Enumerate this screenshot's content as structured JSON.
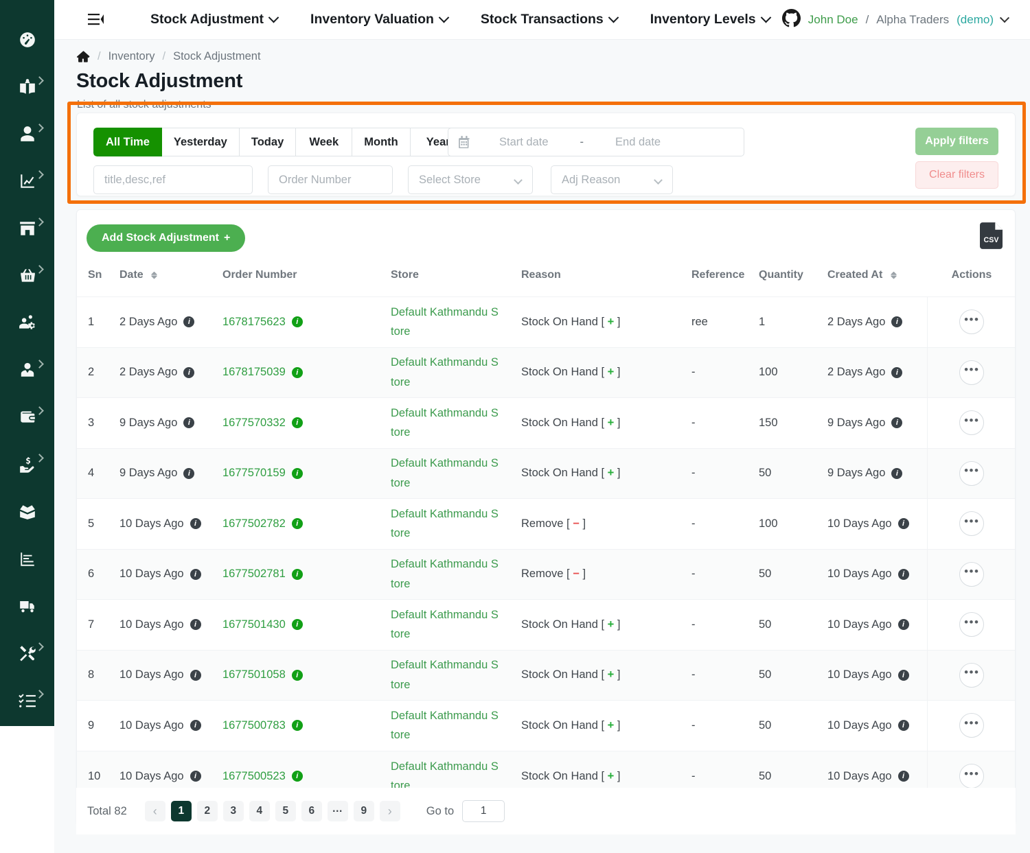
{
  "sidebar": {
    "items": [
      {
        "icon": "dashboard-gauge-icon",
        "expandable": false
      },
      {
        "icon": "book-user-icon",
        "expandable": true
      },
      {
        "icon": "user-icon",
        "expandable": true
      },
      {
        "icon": "chart-line-icon",
        "expandable": true
      },
      {
        "icon": "store-icon",
        "expandable": true
      },
      {
        "icon": "shopping-basket-icon",
        "expandable": true
      },
      {
        "icon": "users-cog-icon",
        "expandable": false
      },
      {
        "icon": "user-tie-icon",
        "expandable": true
      },
      {
        "icon": "wallet-icon",
        "expandable": true
      },
      {
        "icon": "hand-holding-dollar-icon",
        "expandable": true
      },
      {
        "icon": "box-open-icon",
        "expandable": false
      },
      {
        "icon": "chart-bar-report-icon",
        "expandable": false
      },
      {
        "icon": "truck-delivery-icon",
        "expandable": false
      },
      {
        "icon": "tools-icon",
        "expandable": true
      },
      {
        "icon": "tasks-checklist-icon",
        "expandable": true
      }
    ]
  },
  "topnav": {
    "menu_icon": "hamburger-collapse-icon",
    "links": [
      {
        "label": "Stock Adjustment"
      },
      {
        "label": "Inventory Valuation"
      },
      {
        "label": "Stock Transactions"
      },
      {
        "label": "Inventory Levels"
      }
    ],
    "user": {
      "avatar_icon": "github-mark-icon",
      "name": "John Doe",
      "separator": "/",
      "org": "Alpha Traders",
      "mode": "(demo)"
    }
  },
  "breadcrumb": {
    "home_icon": "home-icon",
    "sep": "/",
    "items": [
      "Inventory",
      "Stock Adjustment"
    ]
  },
  "header": {
    "title": "Stock Adjustment",
    "subtitle": "List of all stock adjustments"
  },
  "filters": {
    "ranges": [
      {
        "label": "All Time",
        "active": true
      },
      {
        "label": "Yesterday",
        "active": false
      },
      {
        "label": "Today",
        "active": false
      },
      {
        "label": "Week",
        "active": false
      },
      {
        "label": "Month",
        "active": false
      },
      {
        "label": "Year",
        "active": false
      }
    ],
    "date_icon": "calendar-icon",
    "start_date_placeholder": "Start date",
    "date_separator": "-",
    "end_date_placeholder": "End date",
    "search_placeholder": "title,desc,ref",
    "order_placeholder": "Order Number",
    "store_placeholder": "Select Store",
    "reason_placeholder": "Adj Reason",
    "apply_label": "Apply filters",
    "clear_label": "Clear filters"
  },
  "toolbar": {
    "add_label": "Add Stock Adjustment",
    "add_plus": "+",
    "export_icon": "csv-file-icon",
    "export_text": "CSV"
  },
  "table": {
    "columns": [
      {
        "label": "Sn",
        "sortable": false
      },
      {
        "label": "Date",
        "sortable": true
      },
      {
        "label": "Order Number",
        "sortable": false
      },
      {
        "label": "Store",
        "sortable": false
      },
      {
        "label": "Reason",
        "sortable": false
      },
      {
        "label": "Reference",
        "sortable": false
      },
      {
        "label": "Quantity",
        "sortable": false
      },
      {
        "label": "Created At",
        "sortable": true
      },
      {
        "label": "Actions",
        "sortable": false
      }
    ],
    "store_name": "Default Kathmandu Store",
    "actions_glyph": "•••",
    "rows": [
      {
        "sn": "1",
        "date": "2 Days Ago",
        "order": "1678175623",
        "store": "Default Kathmandu Store",
        "reason": "Stock On Hand",
        "sign": "+",
        "reference": "ree",
        "quantity": "1",
        "created": "2 Days Ago"
      },
      {
        "sn": "2",
        "date": "2 Days Ago",
        "order": "1678175039",
        "store": "Default Kathmandu Store",
        "reason": "Stock On Hand",
        "sign": "+",
        "reference": "-",
        "quantity": "100",
        "created": "2 Days Ago"
      },
      {
        "sn": "3",
        "date": "9 Days Ago",
        "order": "1677570332",
        "store": "Default Kathmandu Store",
        "reason": "Stock On Hand",
        "sign": "+",
        "reference": "-",
        "quantity": "150",
        "created": "9 Days Ago"
      },
      {
        "sn": "4",
        "date": "9 Days Ago",
        "order": "1677570159",
        "store": "Default Kathmandu Store",
        "reason": "Stock On Hand",
        "sign": "+",
        "reference": "-",
        "quantity": "50",
        "created": "9 Days Ago"
      },
      {
        "sn": "5",
        "date": "10 Days Ago",
        "order": "1677502782",
        "store": "Default Kathmandu Store",
        "reason": "Remove",
        "sign": "-",
        "reference": "-",
        "quantity": "100",
        "created": "10 Days Ago"
      },
      {
        "sn": "6",
        "date": "10 Days Ago",
        "order": "1677502781",
        "store": "Default Kathmandu Store",
        "reason": "Remove",
        "sign": "-",
        "reference": "-",
        "quantity": "50",
        "created": "10 Days Ago"
      },
      {
        "sn": "7",
        "date": "10 Days Ago",
        "order": "1677501430",
        "store": "Default Kathmandu Store",
        "reason": "Stock On Hand",
        "sign": "+",
        "reference": "-",
        "quantity": "50",
        "created": "10 Days Ago"
      },
      {
        "sn": "8",
        "date": "10 Days Ago",
        "order": "1677501058",
        "store": "Default Kathmandu Store",
        "reason": "Stock On Hand",
        "sign": "+",
        "reference": "-",
        "quantity": "50",
        "created": "10 Days Ago"
      },
      {
        "sn": "9",
        "date": "10 Days Ago",
        "order": "1677500783",
        "store": "Default Kathmandu Store",
        "reason": "Stock On Hand",
        "sign": "+",
        "reference": "-",
        "quantity": "50",
        "created": "10 Days Ago"
      },
      {
        "sn": "10",
        "date": "10 Days Ago",
        "order": "1677500523",
        "store": "Default Kathmandu Store",
        "reason": "Stock On Hand",
        "sign": "+",
        "reference": "-",
        "quantity": "50",
        "created": "10 Days Ago"
      }
    ]
  },
  "pagination": {
    "total_label": "Total 82",
    "prev": "‹",
    "next": "›",
    "pages": [
      "1",
      "2",
      "3",
      "4",
      "5",
      "6",
      "…",
      "9"
    ],
    "active_page": "1",
    "goto_label": "Go to",
    "goto_value": "1"
  },
  "colors": {
    "sidebar_bg": "#0d382f",
    "primary_green": "#4caf50",
    "active_seg_green": "#159100",
    "link_green": "#3c9b4d",
    "highlight_orange": "#f4700a",
    "danger_red": "#e74c4c",
    "demo_teal": "#2ba8a0"
  }
}
